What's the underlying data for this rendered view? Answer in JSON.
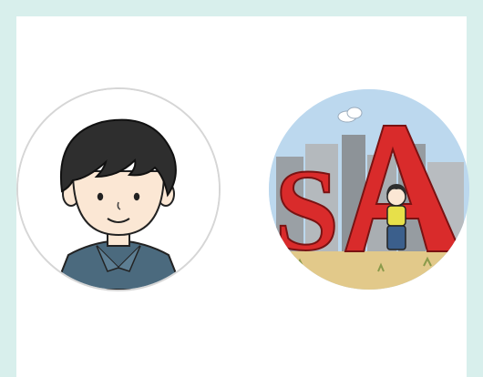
{
  "avatars": [
    {
      "name": "avatar-man-illustration"
    },
    {
      "name": "avatar-sa-illustration",
      "lettering": "SA"
    }
  ],
  "colors": {
    "page_bg": "#d8efec",
    "card_bg": "#ffffff",
    "ring": "#d6d6d6",
    "hair": "#2e2e2e",
    "shirt": "#4b6a7e",
    "letters": "#d92b2b",
    "sky": "#bcd8ee",
    "ground": "#e2c98a"
  }
}
